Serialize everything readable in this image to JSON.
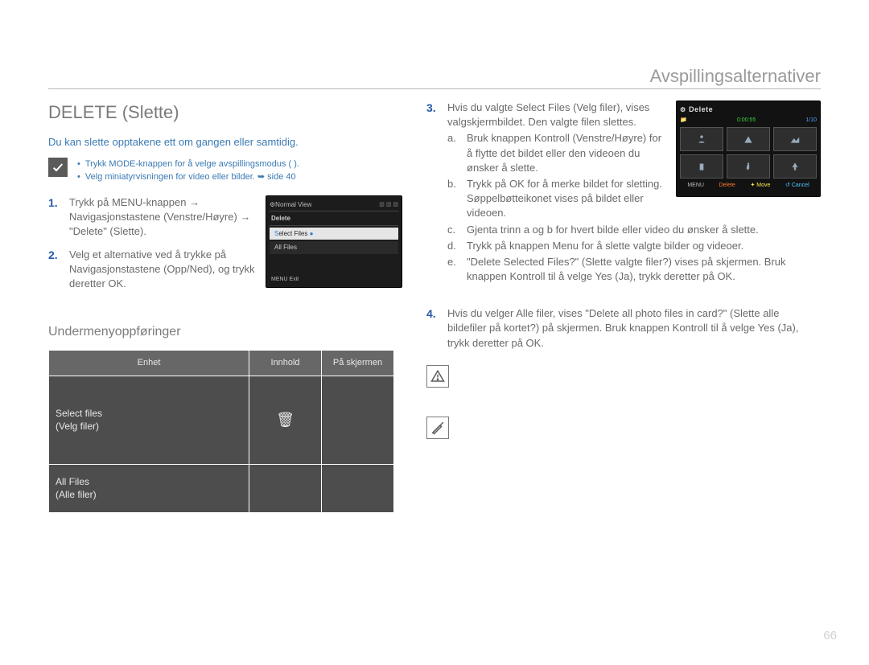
{
  "header": {
    "title": "Avspillingsalternativer"
  },
  "page_number": "66",
  "left": {
    "section_title": "DELETE (Slette)",
    "intro_blue": "Du kan slette opptakene ett om gangen eller samtidig.",
    "note_bullets": [
      "Trykk MODE-knappen for å velge avspillingsmodus (    ).",
      "Velg miniatyrvisningen for video eller bilder. ➥ side 40"
    ],
    "step1_num": "1.",
    "step1_text": "Trykk på MENU-knappen → Navigasjonstastene (Venstre/Høyre) → \"Delete\" (Slette).",
    "step2_num": "2.",
    "step2_text": "Velg et alternative ved å trykke på Navigasjonstastene (Opp/Ned), og trykk deretter OK.",
    "mini_screen": {
      "top": "Normal View",
      "tabs": [
        "",
        "",
        "",
        ""
      ],
      "menu_label": "Delete",
      "row_selected": "Select Files",
      "row_other": "All Files",
      "bottom_label": "MENU  Exit"
    },
    "submenu_title": "Undermenyoppføringer",
    "table": {
      "headers": [
        "Enhet",
        "Innhold",
        "På skjermen"
      ],
      "row1_c1a": "Select files",
      "row1_c1b": "(Velg filer)",
      "row2_c1a": "All Files",
      "row2_c1b": "(Alle filer)"
    }
  },
  "right": {
    "step3_num": "3.",
    "step3_intro": "Hvis du valgte Select Files (Velg filer), vises valgskjermbildet. Den valgte filen slettes.",
    "step3_a_letter": "a.",
    "step3_a": "Bruk knappen Kontroll (Venstre/Høyre) for å flytte det bildet eller den videoen du ønsker å slette.",
    "step3_b_letter": "b.",
    "step3_b": "Trykk på OK for å merke bildet for sletting. Søppelbøtteikonet vises på bildet eller videoen.",
    "step3_c_letter": "c.",
    "step3_c": "Gjenta trinn a og b for hvert bilde eller video du ønsker å slette.",
    "step3_d_letter": "d.",
    "step3_d": "Trykk på knappen Menu for å slette valgte bilder og videoer.",
    "step3_e_letter": "e.",
    "step3_e": "\"Delete Selected Files?\" (Slette valgte filer?) vises på skjermen. Bruk knappen Kontroll til å velge Yes (Ja), trykk deretter på OK.",
    "step4_num": "4.",
    "step4_text": "Hvis du velger Alle filer, vises \"Delete all photo files in card?\" (Slette alle bildefiler på kortet?) på skjermen. Bruk knappen Kontroll til å velge Yes (Ja), trykk deretter på OK.",
    "device": {
      "title": "Delete",
      "time": "0:00:55",
      "count": "1/10",
      "bottom_menu": "MENU",
      "bottom_delete": "Delete",
      "bottom_move": "Move",
      "bottom_cancel": "Cancel"
    }
  }
}
